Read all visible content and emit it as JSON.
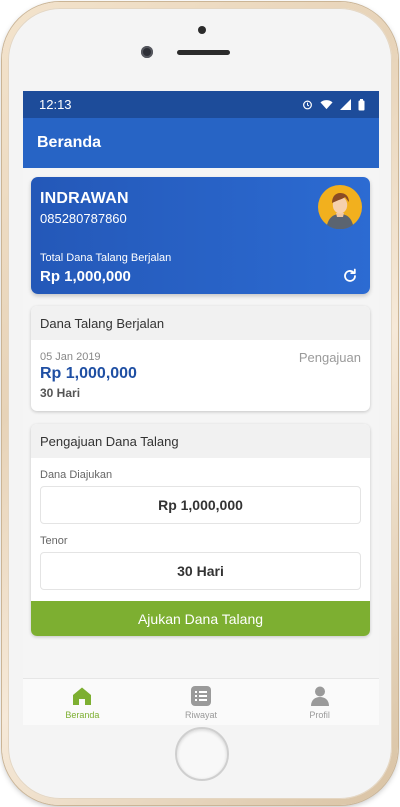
{
  "status_bar": {
    "time": "12:13"
  },
  "app_bar": {
    "title": "Beranda"
  },
  "profile": {
    "name": "INDRAWAN",
    "phone": "085280787860",
    "total_label": "Total Dana Talang Berjalan",
    "total_value": "Rp 1,000,000"
  },
  "running": {
    "header": "Dana Talang Berjalan",
    "date": "05 Jan 2019",
    "status": "Pengajuan",
    "amount": "Rp 1,000,000",
    "tenor": "30 Hari"
  },
  "apply": {
    "header": "Pengajuan Dana Talang",
    "amount_label": "Dana Diajukan",
    "amount_value": "Rp 1,000,000",
    "tenor_label": "Tenor",
    "tenor_value": "30 Hari",
    "submit_label": "Ajukan Dana Talang"
  },
  "nav": {
    "items": [
      {
        "label": "Beranda",
        "icon": "home-icon",
        "active": true
      },
      {
        "label": "Riwayat",
        "icon": "list-icon",
        "active": false
      },
      {
        "label": "Profil",
        "icon": "person-icon",
        "active": false
      }
    ]
  },
  "colors": {
    "primary": "#2764c5",
    "status_bar": "#1d4c9a",
    "accent_green": "#7daf31",
    "amount_blue": "#1f4fa3"
  }
}
